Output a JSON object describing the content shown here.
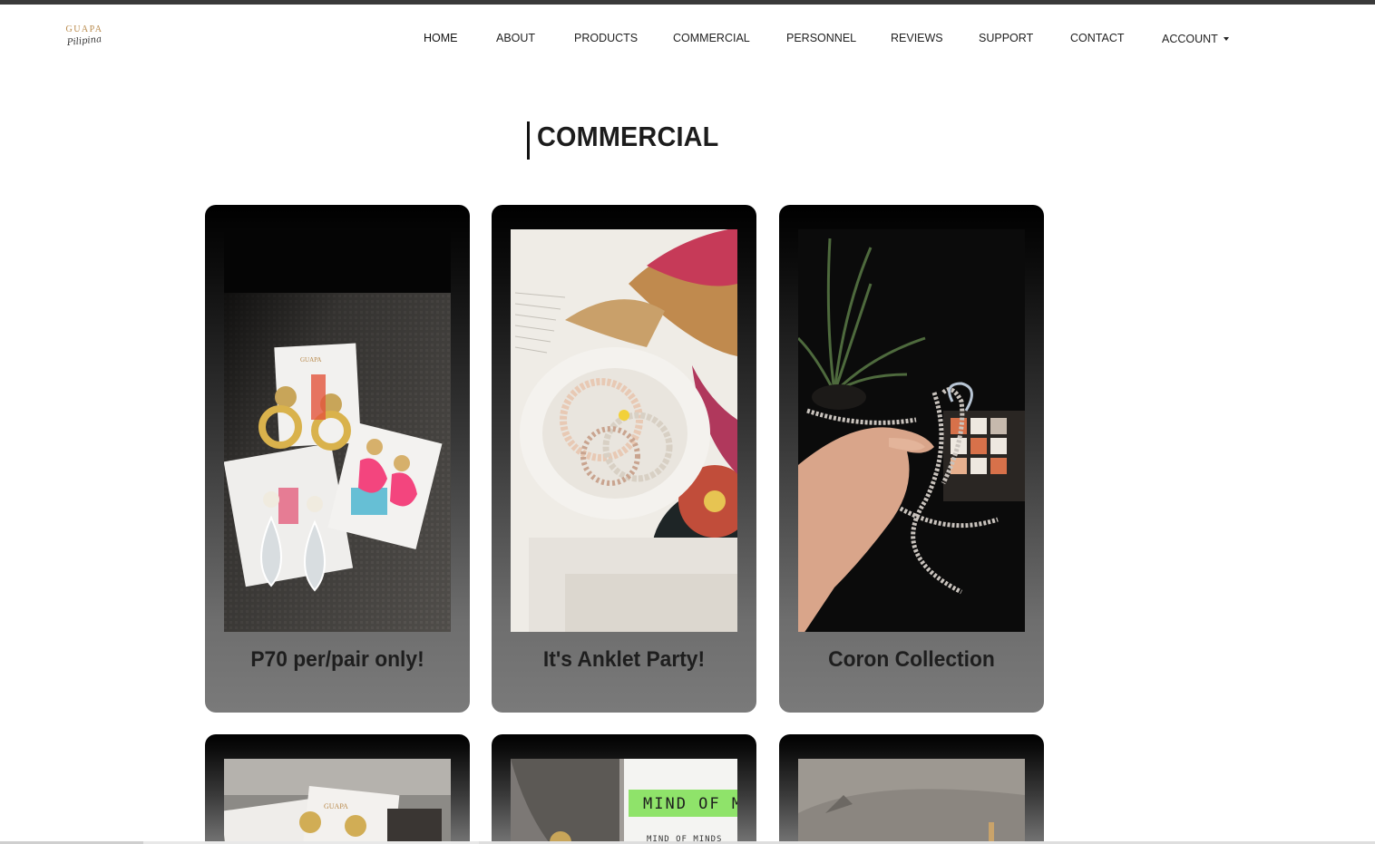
{
  "brand": {
    "name_top": "GUAPA",
    "name_script": "Pilipina"
  },
  "nav": {
    "items": [
      {
        "label": "HOME"
      },
      {
        "label": "ABOUT"
      },
      {
        "label": "PRODUCTS"
      },
      {
        "label": "COMMERCIAL"
      },
      {
        "label": "PERSONNEL"
      },
      {
        "label": "REVIEWS"
      },
      {
        "label": "SUPPORT"
      },
      {
        "label": "CONTACT"
      },
      {
        "label": "ACCOUNT"
      }
    ]
  },
  "page": {
    "title": "COMMERCIAL"
  },
  "cards": [
    {
      "caption": "P70 per/pair only!"
    },
    {
      "caption": "It's Anklet Party!"
    },
    {
      "caption": "Coron Collection"
    },
    {
      "caption": ""
    },
    {
      "caption": ""
    },
    {
      "caption": ""
    }
  ],
  "card_photos": {
    "card5_text": "MIND OF M",
    "card5_subtext": "MIND OF MINDS"
  },
  "colors": {
    "topbar": "#3a3a3a",
    "card_top": "#000000",
    "card_bottom": "#7a7a7a"
  }
}
